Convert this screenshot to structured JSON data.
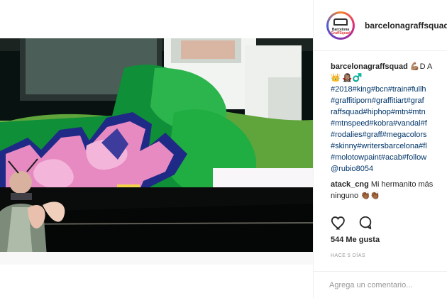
{
  "post": {
    "username": "barcelonagraffsquad",
    "avatar_text_top": "Barcelona",
    "avatar_text_bottom": "GraffSquad"
  },
  "caption": {
    "line1_user": "barcelonagraffsquad",
    "line1_text": "💪🏽D A",
    "line2": "👑 🧛🏽‍♀️♂️",
    "line3": "#2018#king#bcn#train#fullh",
    "line4": "#graffitiporn#graffitiart#graf",
    "line5": "raffsquad#hiphop#mtn#mtn",
    "line6": "#mtnspeed#kobra#vandal#f",
    "line7": "#rodalies#graff#megacolors",
    "line8": "#skinny#writersbarcelona#fl",
    "line9": "#molotowpaint#acab#follow",
    "line10": "@rubio8054"
  },
  "comment": {
    "user": "atack_cng",
    "text": "Mi hermanito más",
    "text2": "ninguno 👏🏾👏🏾"
  },
  "likes_text": "544 Me gusta",
  "time_text": "HACE 5 DÍAS",
  "comment_box": {
    "placeholder": "Agrega un comentario..."
  },
  "icons": {
    "like": "heart-icon",
    "comment": "comment-icon"
  }
}
